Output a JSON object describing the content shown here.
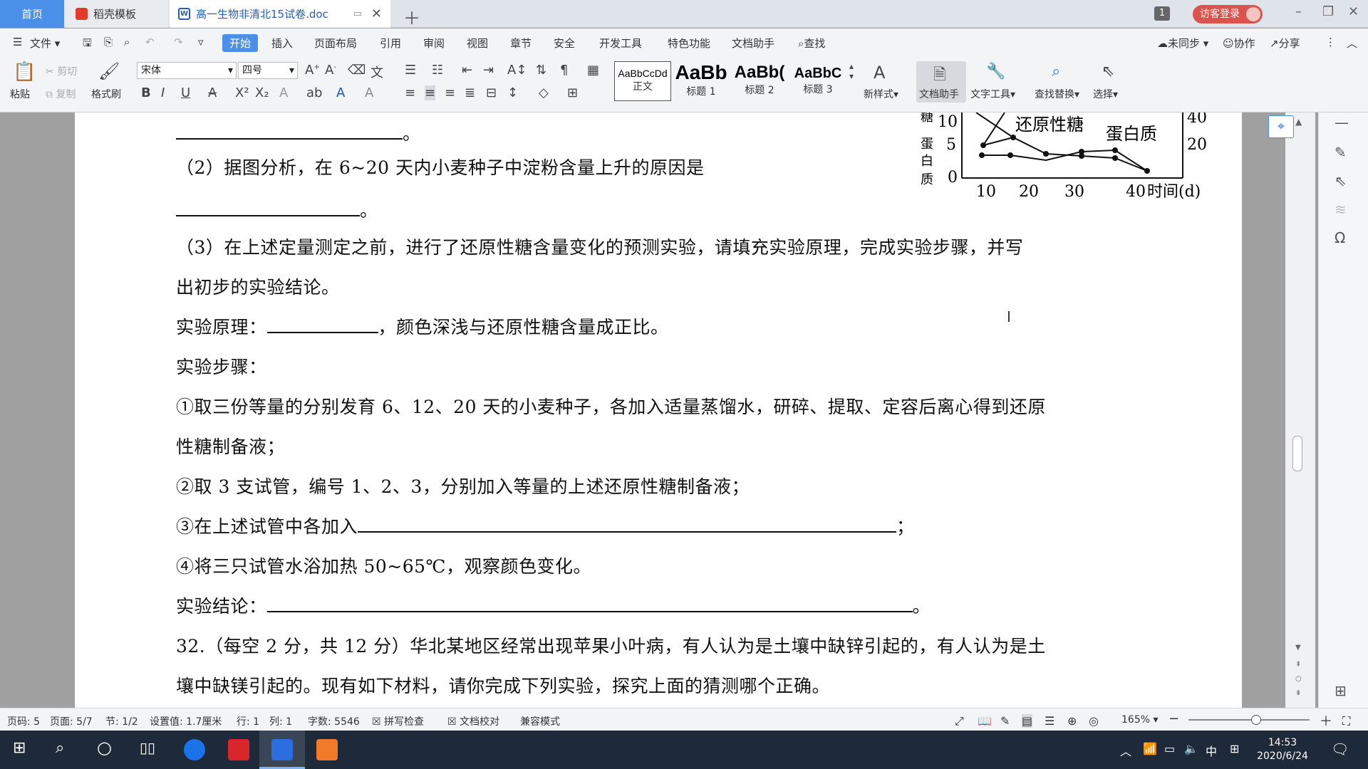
{
  "tabs": {
    "home": "首页",
    "template": "稻壳模板",
    "doc": "高一生物非清北15试卷.doc",
    "notif_count": "1",
    "guest_login": "访客登录"
  },
  "menu": {
    "file": "文件",
    "items": [
      "开始",
      "插入",
      "页面布局",
      "引用",
      "审阅",
      "视图",
      "章节",
      "安全",
      "开发工具",
      "特色功能",
      "文档助手",
      "查找"
    ],
    "sync": "未同步",
    "collab": "协作",
    "share": "分享"
  },
  "ribbon": {
    "paste": "粘贴",
    "cut": "剪切",
    "copy": "复制",
    "format_painter": "格式刷",
    "font_name": "宋体",
    "font_size": "四号",
    "styles": [
      {
        "preview": "AaBbCcDd",
        "label": "正文"
      },
      {
        "preview": "AaBb",
        "label": "标题 1"
      },
      {
        "preview": "AaBb(",
        "label": "标题 2"
      },
      {
        "preview": "AaBbC",
        "label": "标题 3"
      }
    ],
    "new_style": "新样式",
    "doc_helper": "文档助手",
    "text_tools": "文字工具",
    "find_replace": "查找替换",
    "select": "选择"
  },
  "chart": {
    "label_sugar": "还原性糖",
    "label_protein": "蛋白质",
    "y_left_tick": "10",
    "y_left_tick2": "5",
    "y_zero": "0",
    "y_right_40": "40",
    "y_right_20": "20",
    "x_ticks": [
      "10",
      "20",
      "30",
      "40"
    ],
    "x_unit": "时间(d)",
    "y_axis_chars": [
      "糖",
      "蛋",
      "白",
      "质"
    ]
  },
  "document": {
    "l1_end": "。",
    "l2": "（2）据图分析，在 6~20 天内小麦种子中淀粉含量上升的原因是",
    "l3_end": "。",
    "l4": "（3）在上述定量测定之前，进行了还原性糖含量变化的预测实验，请填充实验原理，完成实验步骤，并写",
    "l5": "出初步的实验结论。",
    "l6_a": "实验原理：",
    "l6_b": "，颜色深浅与还原性糖含量成正比。",
    "l7": "实验步骤：",
    "l8": "①取三份等量的分别发育 6、12、20 天的小麦种子，各加入适量蒸馏水，研碎、提取、定容后离心得到还原",
    "l9": "性糖制备液；",
    "l10": "②取 3 支试管，编号 1、2、3，分别加入等量的上述还原性糖制备液；",
    "l11_a": "③在上述试管中各加入",
    "l11_b": "；",
    "l12": "④将三只试管水浴加热 50~65℃，观察颜色变化。",
    "l13_a": "实验结论：",
    "l13_b": "。",
    "l14": "32.（每空 2 分，共 12 分）华北某地区经常出现苹果小叶病，有人认为是土壤中缺锌引起的，有人认为是土",
    "l15": "壤中缺镁引起的。现有如下材料，请你完成下列实验，探究上面的猜测哪个正确。"
  },
  "status": {
    "page_code": "页码: 5",
    "page": "页面: 5/7",
    "section": "节: 1/2",
    "setting": "设置值: 1.7厘米",
    "row": "行: 1",
    "col": "列: 1",
    "words": "字数: 5546",
    "spell": "拼写检查",
    "proof": "文档校对",
    "compat": "兼容模式",
    "zoom": "165%"
  },
  "taskbar": {
    "ime": "中",
    "time": "14:53",
    "date": "2020/6/24"
  }
}
